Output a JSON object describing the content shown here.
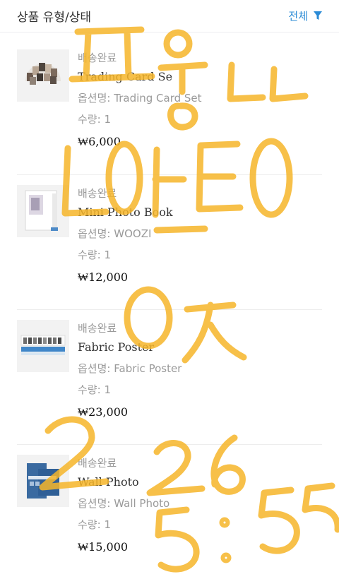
{
  "header": {
    "title": "상품 유형/상태",
    "filter_label": "전체",
    "filter_icon": "filter-icon"
  },
  "items": [
    {
      "status": "배송완료",
      "name": "Trading Card Se",
      "option_label": "옵션명:",
      "option_value": "Trading Card Set",
      "qty_label": "수량:",
      "qty_value": "1",
      "price": "₩6,000"
    },
    {
      "status": "배송완료",
      "name": "Mini Photo Book",
      "option_label": "옵션명:",
      "option_value": "WOOZI",
      "qty_label": "수량:",
      "qty_value": "1",
      "price": "₩12,000"
    },
    {
      "status": "배송완료",
      "name": "Fabric Poster",
      "option_label": "옵션명:",
      "option_value": "Fabric Poster",
      "qty_label": "수량:",
      "qty_value": "1",
      "price": "₩23,000"
    },
    {
      "status": "배송완료",
      "name": "Wall Photo",
      "option_label": "옵션명:",
      "option_value": "Wall Photo",
      "qty_label": "수량:",
      "qty_value": "1",
      "price": "₩15,000"
    }
  ],
  "handwriting": {
    "line1": "포장 ㄴㄴ",
    "line2": "LOEO",
    "line3": "OZ",
    "line4": "2 26",
    "line5": "5:55",
    "color": "#f6b62a"
  }
}
